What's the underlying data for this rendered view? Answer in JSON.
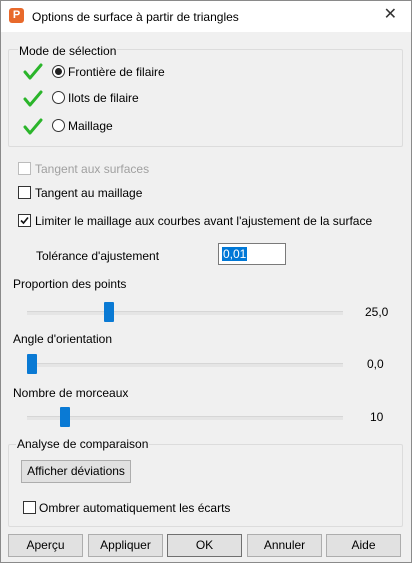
{
  "window": {
    "title": "Options de surface à partir de triangles",
    "icon_letter": "P",
    "close_label": "✕"
  },
  "selection_mode": {
    "legend": "Mode de sélection",
    "options": [
      {
        "label": "Frontière de filaire",
        "selected": true
      },
      {
        "label": "Ilots de filaire",
        "selected": false
      },
      {
        "label": "Maillage",
        "selected": false
      }
    ]
  },
  "options": {
    "tangent_surfaces": {
      "label": "Tangent aux surfaces",
      "checked": false,
      "enabled": false
    },
    "tangent_mesh": {
      "label": "Tangent au maillage",
      "checked": false
    },
    "limit_mesh": {
      "label": "Limiter le maillage aux courbes avant l'ajustement de la surface",
      "checked": true
    }
  },
  "tolerance": {
    "label": "Tolérance d'ajustement",
    "value": "0,01"
  },
  "sliders": {
    "points": {
      "label": "Proportion des points",
      "value_text": "25,0",
      "position": 0.25
    },
    "angle": {
      "label": "Angle d'orientation",
      "value_text": "0,0",
      "position": 0.0
    },
    "pieces": {
      "label": "Nombre de morceaux",
      "value_text": "10",
      "position": 0.12
    }
  },
  "comparison": {
    "legend": "Analyse de comparaison",
    "show_button": "Afficher déviations",
    "auto_shade": {
      "label": "Ombrer automatiquement les écarts",
      "checked": false
    }
  },
  "buttons": {
    "preview": "Aperçu",
    "apply": "Appliquer",
    "ok": "OK",
    "cancel": "Annuler",
    "help": "Aide"
  },
  "colors": {
    "accent": "#0078d7",
    "check_green": "#2bb52b"
  }
}
